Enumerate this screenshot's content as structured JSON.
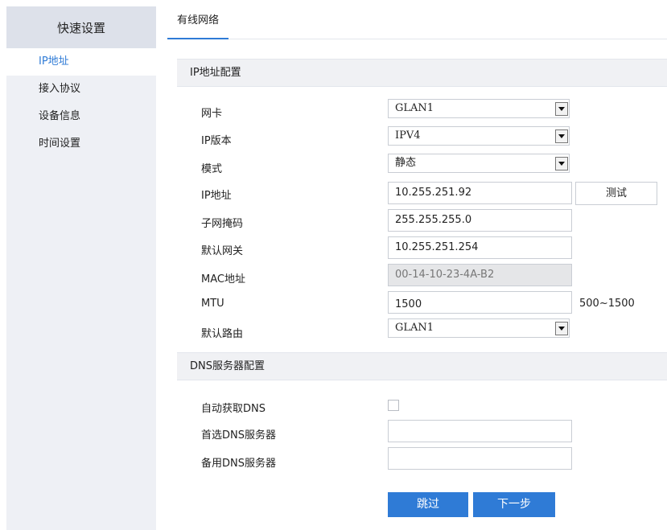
{
  "sidebar": {
    "title": "快速设置",
    "items": [
      {
        "label": "IP地址",
        "active": true
      },
      {
        "label": "接入协议",
        "active": false
      },
      {
        "label": "设备信息",
        "active": false
      },
      {
        "label": "时间设置",
        "active": false
      }
    ]
  },
  "tabs": [
    {
      "label": "有线网络",
      "active": true
    }
  ],
  "ip_section": {
    "title": "IP地址配置",
    "fields": {
      "nic": {
        "label": "网卡",
        "value": "GLAN1"
      },
      "ip_version": {
        "label": "IP版本",
        "value": "IPV4"
      },
      "mode": {
        "label": "模式",
        "value": "静态"
      },
      "ip_address": {
        "label": "IP地址",
        "value": "10.255.251.92",
        "test_button": "测试"
      },
      "subnet_mask": {
        "label": "子网掩码",
        "value": "255.255.255.0"
      },
      "gateway": {
        "label": "默认网关",
        "value": "10.255.251.254"
      },
      "mac": {
        "label": "MAC地址",
        "value": "00-14-10-23-4A-B2"
      },
      "mtu": {
        "label": "MTU",
        "value": "1500",
        "range": "500~1500"
      },
      "default_route": {
        "label": "默认路由",
        "value": "GLAN1"
      }
    }
  },
  "dns_section": {
    "title": "DNS服务器配置",
    "fields": {
      "auto_dns": {
        "label": "自动获取DNS",
        "checked": false
      },
      "primary_dns": {
        "label": "首选DNS服务器",
        "value": ""
      },
      "secondary_dns": {
        "label": "备用DNS服务器",
        "value": ""
      }
    }
  },
  "actions": {
    "skip": "跳过",
    "next": "下一步"
  },
  "colors": {
    "accent": "#2f7bd6",
    "sidebar_bg": "#eef0f5",
    "sidebar_header_bg": "#dde1ea",
    "section_bg": "#f0f1f4",
    "disabled_bg": "#e5e6e8"
  }
}
